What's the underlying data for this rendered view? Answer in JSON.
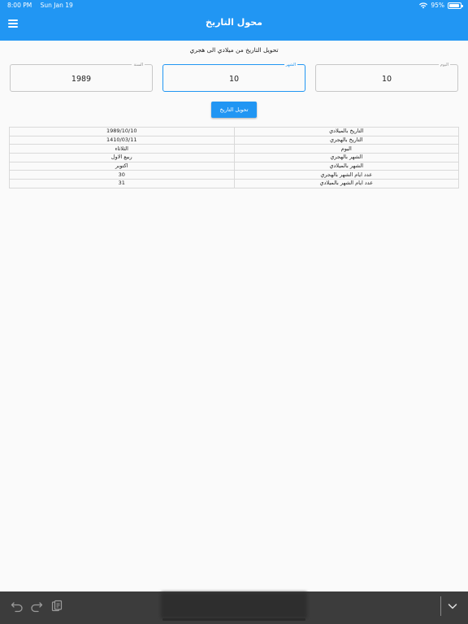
{
  "status": {
    "time": "8:00 PM",
    "date": "Sun Jan 19",
    "battery": "95%",
    "battery_level": 0.95
  },
  "appbar": {
    "title": "محول التاريخ",
    "menu_icon": "hamburger-menu-icon"
  },
  "subtitle": "تحويل التاريخ من ميلادي الى هجري",
  "fields": {
    "year": {
      "label": "السنة",
      "value": "1989"
    },
    "month": {
      "label": "الشهر",
      "value": "10"
    },
    "day": {
      "label": "اليوم",
      "value": "10"
    }
  },
  "convert_button": "تحويل التاريخ",
  "results": [
    {
      "value": "1989/10/10",
      "key": "التاريخ بالميلادي"
    },
    {
      "value": "1410/03/11",
      "key": "التاريخ بالهجري"
    },
    {
      "value": "الثلاثاء",
      "key": "اليوم"
    },
    {
      "value": "ربيع الاول",
      "key": "الشهر بالهجري"
    },
    {
      "value": "اكتوبر",
      "key": "الشهر بالميلادي"
    },
    {
      "value": "30",
      "key": "عدد ايام الشهر بالهجري"
    },
    {
      "value": "31",
      "key": "عدد ايام الشهر بالميلادي"
    }
  ],
  "toolbar": {
    "undo_icon": "undo-icon",
    "redo_icon": "redo-icon",
    "paste_icon": "clipboard-icon",
    "dismiss_icon": "chevron-down-icon"
  },
  "colors": {
    "primary": "#2196f3",
    "background": "#fafafa",
    "toolbar": "#3c3c3c"
  }
}
